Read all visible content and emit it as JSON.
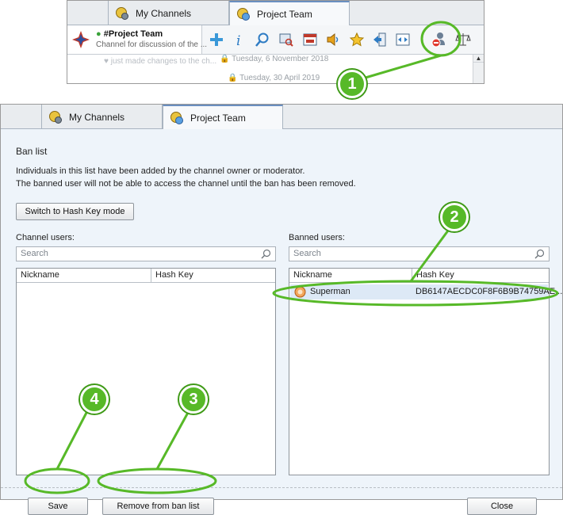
{
  "inset": {
    "tabs": [
      "My Channels",
      "Project Team"
    ],
    "channel_name": "#Project Team",
    "channel_desc": "Channel for discussion of the ...",
    "feed_lines": [
      "just made changes to the ch...",
      "Tuesday, 6 November 2018",
      "Tuesday, 30 April 2019"
    ],
    "toolbar_icons": [
      "add-icon",
      "info-icon",
      "search-icon",
      "chat-search-icon",
      "record-icon",
      "speaker-icon",
      "star-icon",
      "exit-icon",
      "expand-icon",
      "ban-user-icon",
      "scales-icon"
    ]
  },
  "window": {
    "tabs": [
      "My Channels",
      "Project Team"
    ],
    "title": "Ban list",
    "description_line1": "Individuals in this list have been added by the channel owner or moderator.",
    "description_line2": "The banned user will not be able to access the channel until the ban has been removed.",
    "switch_button": "Switch to Hash Key mode",
    "channel_users": {
      "label": "Channel users:",
      "search_placeholder": "Search",
      "columns": [
        "Nickname",
        "Hash Key"
      ],
      "rows": []
    },
    "banned_users": {
      "label": "Banned users:",
      "search_placeholder": "Search",
      "columns": [
        "Nickname",
        "Hash Key"
      ],
      "rows": [
        {
          "nickname": "Superman",
          "hash_key": "DB6147AECDC0F8F6B9B74759AE..."
        }
      ]
    },
    "buttons": {
      "save": "Save",
      "remove": "Remove from ban list",
      "close": "Close"
    }
  },
  "annotations": [
    "1",
    "2",
    "3",
    "4"
  ],
  "colors": {
    "annotation": "#57b928",
    "tab_accent": "#6a8fc0"
  }
}
